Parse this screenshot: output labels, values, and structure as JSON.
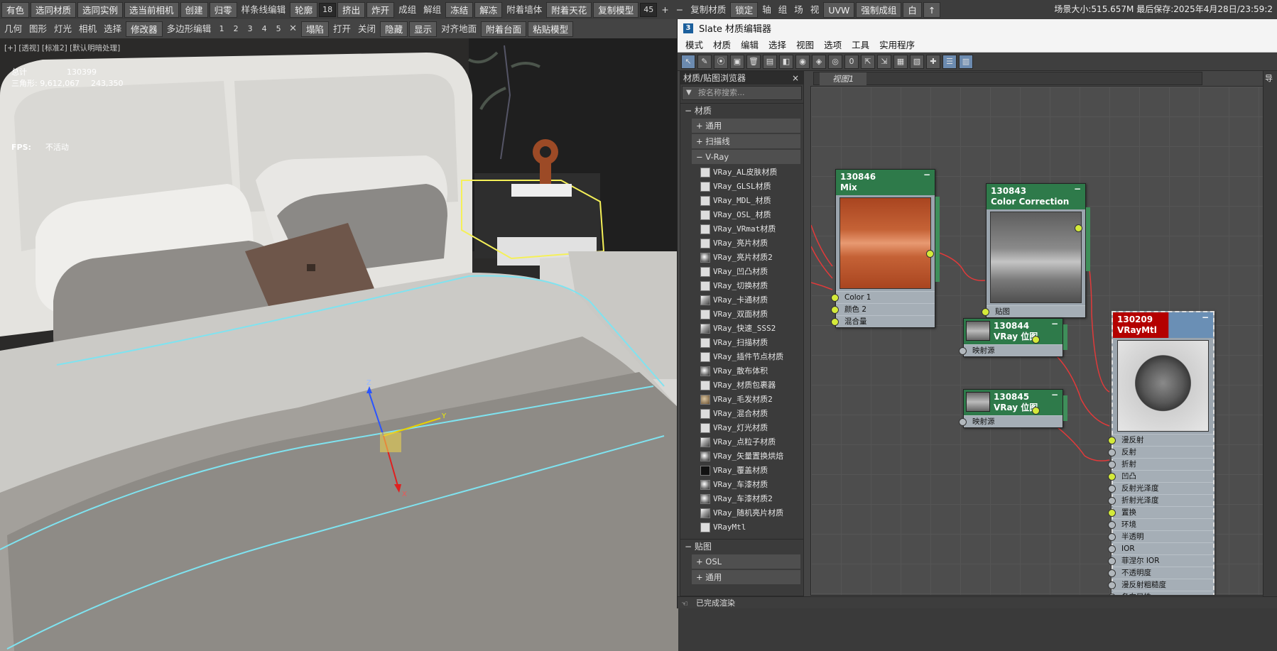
{
  "toolbar1": {
    "items": [
      {
        "t": "btn",
        "label": "有色"
      },
      {
        "t": "btn",
        "label": "选同材质"
      },
      {
        "t": "btn",
        "label": "选同实例"
      },
      {
        "t": "btn",
        "label": "选当前相机"
      },
      {
        "t": "btn",
        "label": "创建"
      },
      {
        "t": "btn",
        "label": "归零"
      },
      {
        "t": "txt",
        "label": "样条线编辑"
      },
      {
        "t": "btn",
        "label": "轮廓"
      },
      {
        "t": "spin",
        "label": "18"
      },
      {
        "t": "btn",
        "label": "挤出"
      },
      {
        "t": "btn",
        "label": "炸开"
      },
      {
        "t": "txt",
        "label": "成组"
      },
      {
        "t": "txt",
        "label": "解组"
      },
      {
        "t": "btn",
        "label": "冻结"
      },
      {
        "t": "btn",
        "label": "解冻"
      },
      {
        "t": "txt",
        "label": "附着墙体"
      },
      {
        "t": "btn",
        "label": "附着天花"
      },
      {
        "t": "btn",
        "label": "复制模型"
      },
      {
        "t": "spin",
        "label": "45"
      },
      {
        "t": "txt",
        "label": "+"
      },
      {
        "t": "txt",
        "label": "−"
      },
      {
        "t": "txt",
        "label": "复制材质"
      },
      {
        "t": "btn",
        "label": "锁定"
      },
      {
        "t": "txt",
        "label": "轴"
      },
      {
        "t": "txt",
        "label": "组"
      },
      {
        "t": "txt",
        "label": "场"
      },
      {
        "t": "txt",
        "label": "视"
      },
      {
        "t": "btn",
        "label": "UVW"
      },
      {
        "t": "btn",
        "label": "强制成组"
      },
      {
        "t": "btn",
        "label": "白"
      },
      {
        "t": "btn",
        "label": "↑"
      }
    ],
    "info": "场景大小:515.657M 最后保存:2025年4月28日/23:59:2"
  },
  "toolbar2": {
    "items": [
      {
        "t": "txt",
        "label": "几何"
      },
      {
        "t": "txt",
        "label": "图形"
      },
      {
        "t": "txt",
        "label": "灯光"
      },
      {
        "t": "txt",
        "label": "相机"
      },
      {
        "t": "txt",
        "label": "选择"
      },
      {
        "t": "btn",
        "label": "修改器"
      },
      {
        "t": "txt",
        "label": "多边形编辑"
      },
      {
        "t": "num",
        "label": "1"
      },
      {
        "t": "num",
        "label": "2"
      },
      {
        "t": "num",
        "label": "3"
      },
      {
        "t": "num",
        "label": "4"
      },
      {
        "t": "num",
        "label": "5"
      },
      {
        "t": "icon",
        "label": "✕"
      },
      {
        "t": "btn",
        "label": "塌陷"
      },
      {
        "t": "txt",
        "label": "打开"
      },
      {
        "t": "txt",
        "label": "关闭"
      },
      {
        "t": "btn",
        "label": "隐藏"
      },
      {
        "t": "btn",
        "label": "显示"
      },
      {
        "t": "txt",
        "label": "对齐地面"
      },
      {
        "t": "btn",
        "label": "附着台面"
      },
      {
        "t": "btn",
        "label": "粘贴模型"
      }
    ]
  },
  "viewport": {
    "label": "[+] [透视] [标准2] [默认明暗处理]",
    "stats": [
      {
        "k": "总计",
        "v": "130399",
        "v2": ""
      },
      {
        "k": "三角形: 9,612,067",
        "v": "243,350",
        "v2": ""
      }
    ],
    "fps_label": "FPS:",
    "fps_value": "不活动",
    "gizmo": {
      "x": "X",
      "y": "Y",
      "z": "Z"
    }
  },
  "medit": {
    "title": "Slate 材质编辑器",
    "title_icon": "3",
    "menu": [
      "模式",
      "材质",
      "编辑",
      "选择",
      "视图",
      "选项",
      "工具",
      "实用程序"
    ],
    "browser_title": "材质/贴图浏览器",
    "search_placeholder": "按名称搜索...",
    "cat_materials": "材质",
    "sub_general": "通用",
    "sub_scanline": "扫描线",
    "sub_vray": "V-Ray",
    "vray_list": [
      {
        "n": "VRay_AL皮肤材质",
        "s": ""
      },
      {
        "n": "VRay_GLSL材质",
        "s": ""
      },
      {
        "n": "VRay_MDL_材质",
        "s": ""
      },
      {
        "n": "VRay_OSL_材质",
        "s": ""
      },
      {
        "n": "VRay_VRmat材质",
        "s": ""
      },
      {
        "n": "VRay_亮片材质",
        "s": ""
      },
      {
        "n": "VRay_亮片材质2",
        "s": "s"
      },
      {
        "n": "VRay_凹凸材质",
        "s": ""
      },
      {
        "n": "VRay_切换材质",
        "s": ""
      },
      {
        "n": "VRay_卡通材质",
        "s": "m"
      },
      {
        "n": "VRay_双面材质",
        "s": ""
      },
      {
        "n": "VRay_快速_SSS2",
        "s": "m"
      },
      {
        "n": "VRay_扫描材质",
        "s": ""
      },
      {
        "n": "VRay_插件节点材质",
        "s": ""
      },
      {
        "n": "VRay_散布体积",
        "s": "s"
      },
      {
        "n": "VRay_材质包裹器",
        "s": ""
      },
      {
        "n": "VRay_毛发材质2",
        "s": "b"
      },
      {
        "n": "VRay_混合材质",
        "s": ""
      },
      {
        "n": "VRay_灯光材质",
        "s": ""
      },
      {
        "n": "VRay_点粒子材质",
        "s": "m"
      },
      {
        "n": "VRay_矢量置换烘焙",
        "s": "s"
      },
      {
        "n": "VRay_覆盖材质",
        "s": "d"
      },
      {
        "n": "VRay_车漆材质",
        "s": "s"
      },
      {
        "n": "VRay_车漆材质2",
        "s": "s"
      },
      {
        "n": "VRay_随机亮片材质",
        "s": "m"
      },
      {
        "n": "VRayMtl",
        "s": ""
      }
    ],
    "cat_maps": "贴图",
    "sub_osl": "OSL",
    "sub_general2": "通用",
    "view_tab": "视图1",
    "right_strip": "导",
    "status": "已完成渲染",
    "nodes": {
      "mix": {
        "id": "130846",
        "type": "Mix",
        "slots": [
          "Color 1",
          "颜色 2",
          "混合量"
        ]
      },
      "cc": {
        "id": "130843",
        "type": "Color Correction",
        "slots": [
          "贴图"
        ]
      },
      "bmp1": {
        "id": "130844",
        "type": "VRay 位图",
        "slots": [
          "映射源"
        ]
      },
      "bmp2": {
        "id": "130845",
        "type": "VRay 位图",
        "slots": [
          "映射源"
        ]
      },
      "vray": {
        "id": "130209",
        "type": "VRayMtl",
        "slots": [
          "漫反射",
          "反射",
          "折射",
          "凹凸",
          "反射光泽度",
          "折射光泽度",
          "置换",
          "环境",
          "半透明",
          "IOR",
          "菲涅尔 IOR",
          "不透明度",
          "漫反射粗糙度",
          "各向异性"
        ]
      }
    }
  }
}
